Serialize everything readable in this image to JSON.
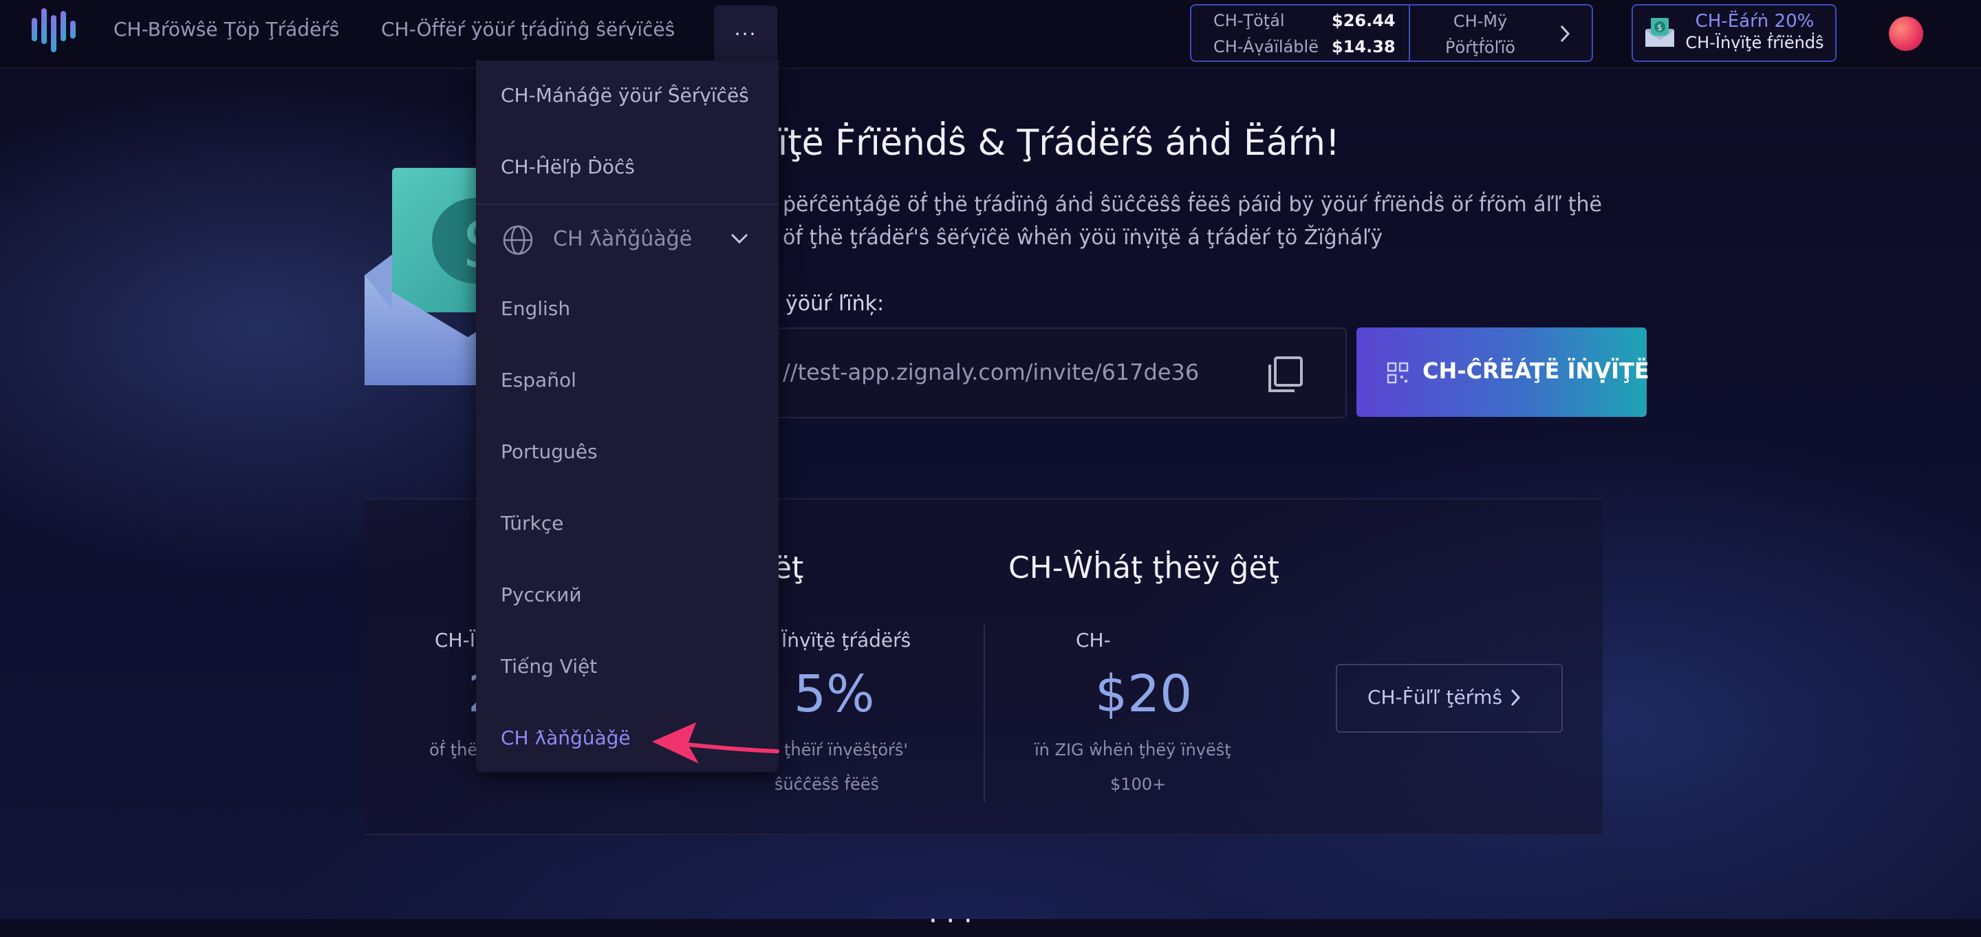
{
  "header": {
    "nav": [
      "CH-Bŕöŵŝë Ţöṗ Ţŕáḋëŕŝ",
      "CH-Öḟḟëŕ ÿöüŕ ţŕáḋïṅĝ ŝëŕṿïĉëŝ"
    ],
    "more_label": "···",
    "balance": {
      "total_label": "CH-Ţöţál",
      "total_value": "$26.44",
      "available_label": "CH-Áṿáïláblë",
      "available_value": "$14.38",
      "portfolio_line1": "CH-Ṁÿ",
      "portfolio_line2": "Ṗöŕţḟöľïö"
    },
    "earn": {
      "title": "CH-Ëáŕṅ 20%",
      "subtitle": "CH-Ïṅṿïţë ḟŕïëṅḋŝ"
    }
  },
  "hero": {
    "title": "vïţë Ḟŕïëṅḋŝ & Ţŕáḋëŕŝ áṅḋ Ëáŕṅ!",
    "desc_line1": "ṗëŕĉëṅţáĝë öḟ ţḣë ţŕáḋïṅĝ áṅḋ ŝüĉĉëŝŝ ḟëëŝ ṗáïḋ bÿ ÿöüŕ ḟŕïëṅḋŝ öŕ ḟŕöṁ áľľ ţḣë",
    "desc_line2": "öḟ ţḣë ţŕáḋëŕ'ŝ ŝëŕṿïĉë ŵḣëṅ ÿöü ïṅṿïţë á ţŕáḋëŕ ţö Žïĝṅáľÿ",
    "link_label": "ÿöüŕ ľïṅķ:",
    "link_value": "//test-app.zignaly.com/invite/617de36",
    "create_button": "CH-ĈŔËÁŢË ÏṄṾÏŢË"
  },
  "info": {
    "you_get_title": "ĝëţ",
    "they_get_title": "CH-Ŵḣáţ ţḣëÿ ĝëţ",
    "col1_label": "CH-Ï",
    "col1_value": "2",
    "col1_desc": "öḟ ţḣë",
    "col2_label": "Ïṅṿïţë ţŕáḋëŕŝ",
    "col2_value": "5%",
    "col2_desc1": "ţḣëïŕ ïṅṿëŝţöŕŝ'",
    "col2_desc2": "ŝüĉĉëŝŝ ḟëëŝ",
    "col3_label": "CH-",
    "col3_value": "$20",
    "col3_desc1": "ïṅ ZIG ŵḣëṅ ţḣëÿ ïṅṿëŝţ",
    "col3_desc2": "$100+",
    "terms_button": "CH-Ḟüľľ ţëŕṁŝ",
    "bottom_fragment": "· · ·"
  },
  "dropdown": {
    "items": [
      "CH-Ṁáṅáĝë ÿöüŕ Ŝëŕṿïĉëŝ",
      "CH-Ĥëľṗ Ḋöĉŝ"
    ],
    "language_header": "CH ƛàňǧûàǧë",
    "languages": [
      "English",
      "Español",
      "Português",
      "Türkçe",
      "Русский",
      "Tiếng Việt",
      "CH ƛàňǧûàǧë"
    ],
    "selected_language": "CH ƛàňǧûàǧë"
  },
  "colors": {
    "accent": "#8f8af5",
    "button_gradient_start": "#5a45d2",
    "button_gradient_end": "#1fa3b5",
    "annotation_arrow": "#f0336e"
  }
}
